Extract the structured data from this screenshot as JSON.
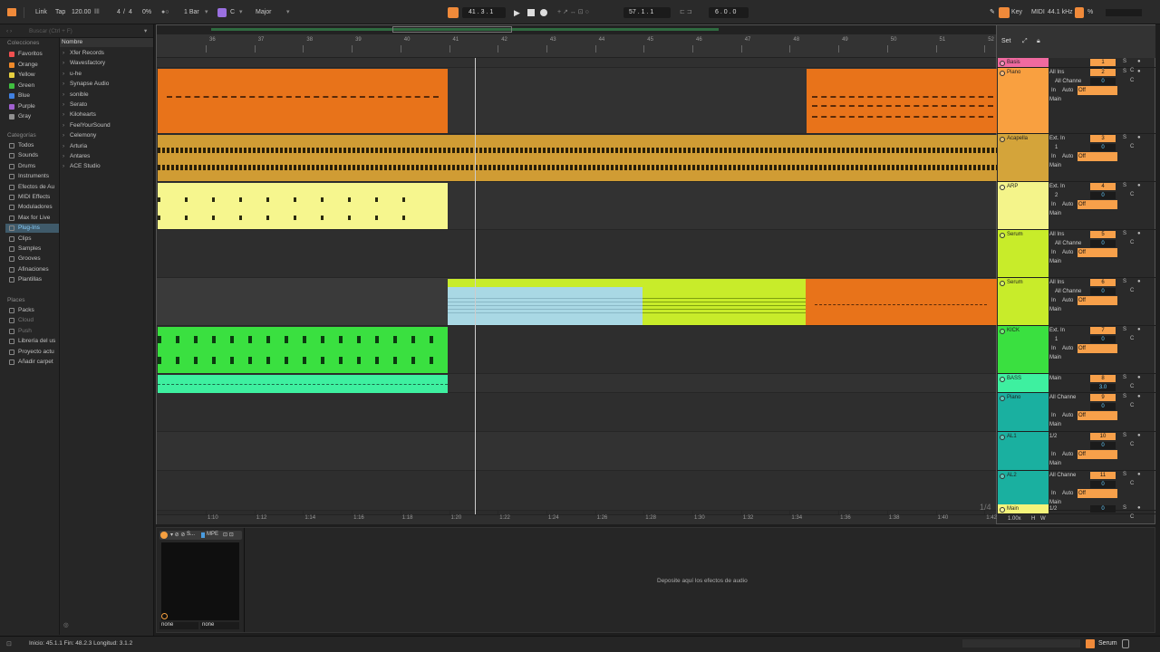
{
  "transport": {
    "link": "Link",
    "tap": "Tap",
    "tempo": "120.00",
    "meter_num": "4",
    "meter_sep": "/",
    "meter_den": "4",
    "cpu": "0%",
    "quantize": "1 Bar",
    "key": "C",
    "scale": "Major",
    "position": "41 .  3 .  1",
    "loop_start": "57 .  1 .  1",
    "loop_len": "6 .  0 .  0",
    "key_label": "Key",
    "midi_label": "MIDI",
    "sample_rate": "44.1 kHz",
    "cpu_meter": "%"
  },
  "browser": {
    "search_placeholder": "Buscar (Ctrl + F)",
    "header_name": "Nombre",
    "collections_title": "Colecciones",
    "collections": [
      {
        "label": "Favoritos",
        "color": "#f05050"
      },
      {
        "label": "Orange",
        "color": "#f08a2a"
      },
      {
        "label": "Yellow",
        "color": "#e8d040"
      },
      {
        "label": "Green",
        "color": "#40c040"
      },
      {
        "label": "Blue",
        "color": "#4080e0"
      },
      {
        "label": "Purple",
        "color": "#a060d0"
      },
      {
        "label": "Gray",
        "color": "#909090"
      }
    ],
    "categories_title": "Categorías",
    "categories": [
      "Todos",
      "Sounds",
      "Drums",
      "Instruments",
      "Efectos de Au",
      "MIDI Effects",
      "Moduladores",
      "Max for Live",
      "Plug-Ins",
      "Clips",
      "Samples",
      "Grooves",
      "Afinaciones",
      "Plantillas"
    ],
    "places_title": "Places",
    "places": [
      "Packs",
      "Cloud",
      "Push",
      "Librería del us",
      "Proyecto actu",
      "Añadir carpet"
    ],
    "items": [
      "Xfer Records",
      "Wavesfactory",
      "u-he",
      "Synapse Audio",
      "sonible",
      "Serato",
      "Kilohearts",
      "FeelYourSound",
      "Celemony",
      "Arturia",
      "Antares",
      "ACE Studio"
    ]
  },
  "ruler": {
    "bars": [
      "36",
      "37",
      "38",
      "39",
      "40",
      "41",
      "42",
      "43",
      "44",
      "45",
      "46",
      "47",
      "48",
      "49",
      "50",
      "51",
      "52"
    ],
    "times": [
      "1:10",
      "1:12",
      "1:14",
      "1:16",
      "1:18",
      "1:20",
      "1:22",
      "1:24",
      "1:26",
      "1:28",
      "1:30",
      "1:32",
      "1:34",
      "1:36",
      "1:38",
      "1:40",
      "1:42"
    ],
    "set_label": "Set",
    "page": "1/4"
  },
  "tracks": [
    {
      "name": "Basis",
      "color": "#f06aa0",
      "input": "",
      "channel": "",
      "number": "1",
      "vol": "0"
    },
    {
      "name": "Piano",
      "color": "#f9a040",
      "input": "All Ins",
      "channel": "All Channe",
      "number": "2",
      "vol": "0",
      "out": "Main"
    },
    {
      "name": "Acapella",
      "color": "#d4a43a",
      "input": "Ext. In",
      "channel": "1",
      "number": "3",
      "vol": "0",
      "out": "Main"
    },
    {
      "name": "ARP",
      "color": "#f4f48a",
      "input": "Ext. In",
      "channel": "2",
      "number": "4",
      "vol": "0",
      "out": "Main"
    },
    {
      "name": "Serum",
      "color": "#c8ec2a",
      "input": "All Ins",
      "channel": "All Channe",
      "number": "5",
      "vol": "0",
      "out": "Main"
    },
    {
      "name": "Serum",
      "color": "#c8ec2a",
      "input": "All Ins",
      "channel": "All Channe",
      "number": "6",
      "vol": "0",
      "out": "Main"
    },
    {
      "name": "KICK",
      "color": "#3ae040",
      "input": "Ext. In",
      "channel": "1",
      "number": "7",
      "vol": "0",
      "out": "Main"
    },
    {
      "name": "BASS",
      "color": "#3ef0a0",
      "input": "Main",
      "channel": "",
      "number": "8",
      "vol": "3.0",
      "out": ""
    },
    {
      "name": "Piano",
      "color": "#1ab0a0",
      "input": "All Channe",
      "channel": "",
      "number": "9",
      "vol": "0",
      "out": "Main"
    },
    {
      "name": "AL1",
      "color": "#1ab0a0",
      "input": "1/2",
      "channel": "",
      "number": "10",
      "vol": "0",
      "out": "Main"
    },
    {
      "name": "AL2",
      "color": "#1ab0a0",
      "input": "All Channe",
      "channel": "",
      "number": "11",
      "vol": "0",
      "out": "Main"
    },
    {
      "name": "Main",
      "color": "#f4f47a",
      "input": "1/2",
      "channel": "",
      "number": "",
      "vol": "0",
      "out": ""
    }
  ],
  "monitor": {
    "in": "In",
    "auto": "Auto",
    "off": "Off"
  },
  "controls": {
    "solo": "S",
    "center": "C",
    "fx_scale": "1.00x",
    "h": "H",
    "w": "W"
  },
  "device": {
    "title": "S...",
    "mpe": "MPE",
    "drop_hint": "Deposite aquí los efectos de audio",
    "in_sel": "none",
    "out_sel": "none"
  },
  "status": {
    "selection": "Inicio: 45.1.1  Fin: 48.2.3  Longitud: 3.1.2",
    "device_name": "Serum"
  }
}
